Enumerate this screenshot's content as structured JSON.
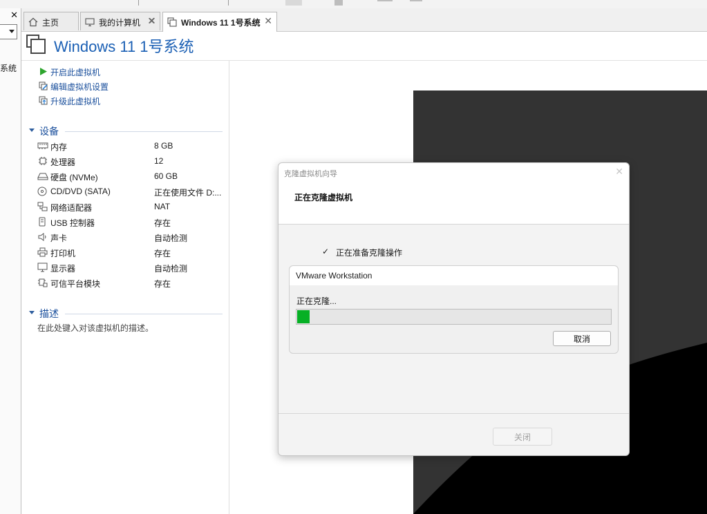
{
  "library": {
    "close_glyph": "✕",
    "partial_text": "系统"
  },
  "tabs": [
    {
      "label": "主页",
      "icon": "home-icon",
      "close": "✕"
    },
    {
      "label": "我的计算机",
      "icon": "computer-icon",
      "close": "✕"
    },
    {
      "label": "Windows 11 1号系统",
      "icon": "vm-icon",
      "close": "✕",
      "active": true
    }
  ],
  "vm": {
    "title": "Windows 11 1号系统"
  },
  "commands": [
    {
      "label": "开启此虚拟机",
      "icon": "play-icon"
    },
    {
      "label": "编辑虚拟机设置",
      "icon": "edit-settings-icon"
    },
    {
      "label": "升级此虚拟机",
      "icon": "upgrade-icon"
    }
  ],
  "devices_section": {
    "label": "设备",
    "items": [
      {
        "name": "内存",
        "value": "8 GB",
        "icon": "memory-icon"
      },
      {
        "name": "处理器",
        "value": "12",
        "icon": "cpu-icon"
      },
      {
        "name": "硬盘 (NVMe)",
        "value": "60 GB",
        "icon": "disk-icon"
      },
      {
        "name": "CD/DVD (SATA)",
        "value": "正在使用文件 D:...",
        "icon": "cd-icon"
      },
      {
        "name": "网络适配器",
        "value": "NAT",
        "icon": "network-icon"
      },
      {
        "name": "USB 控制器",
        "value": "存在",
        "icon": "usb-icon"
      },
      {
        "name": "声卡",
        "value": "自动检测",
        "icon": "speaker-icon"
      },
      {
        "name": "打印机",
        "value": "存在",
        "icon": "printer-icon"
      },
      {
        "name": "显示器",
        "value": "自动检测",
        "icon": "monitor-icon"
      },
      {
        "name": "可信平台模块",
        "value": "存在",
        "icon": "tpm-icon"
      }
    ]
  },
  "description_section": {
    "label": "描述",
    "placeholder": "在此处键入对该虚拟机的描述。"
  },
  "dialog": {
    "title": "克隆虚拟机向导",
    "close_glyph": "✕",
    "heading": "正在克隆虚拟机",
    "step_check": "✓",
    "step_label": "正在准备克隆操作",
    "inner_title": "VMware Workstation",
    "status": "正在克隆...",
    "progress": 0.04,
    "progress_color": "#06b025",
    "cancel_label": "取消",
    "close_label": "关闭"
  }
}
